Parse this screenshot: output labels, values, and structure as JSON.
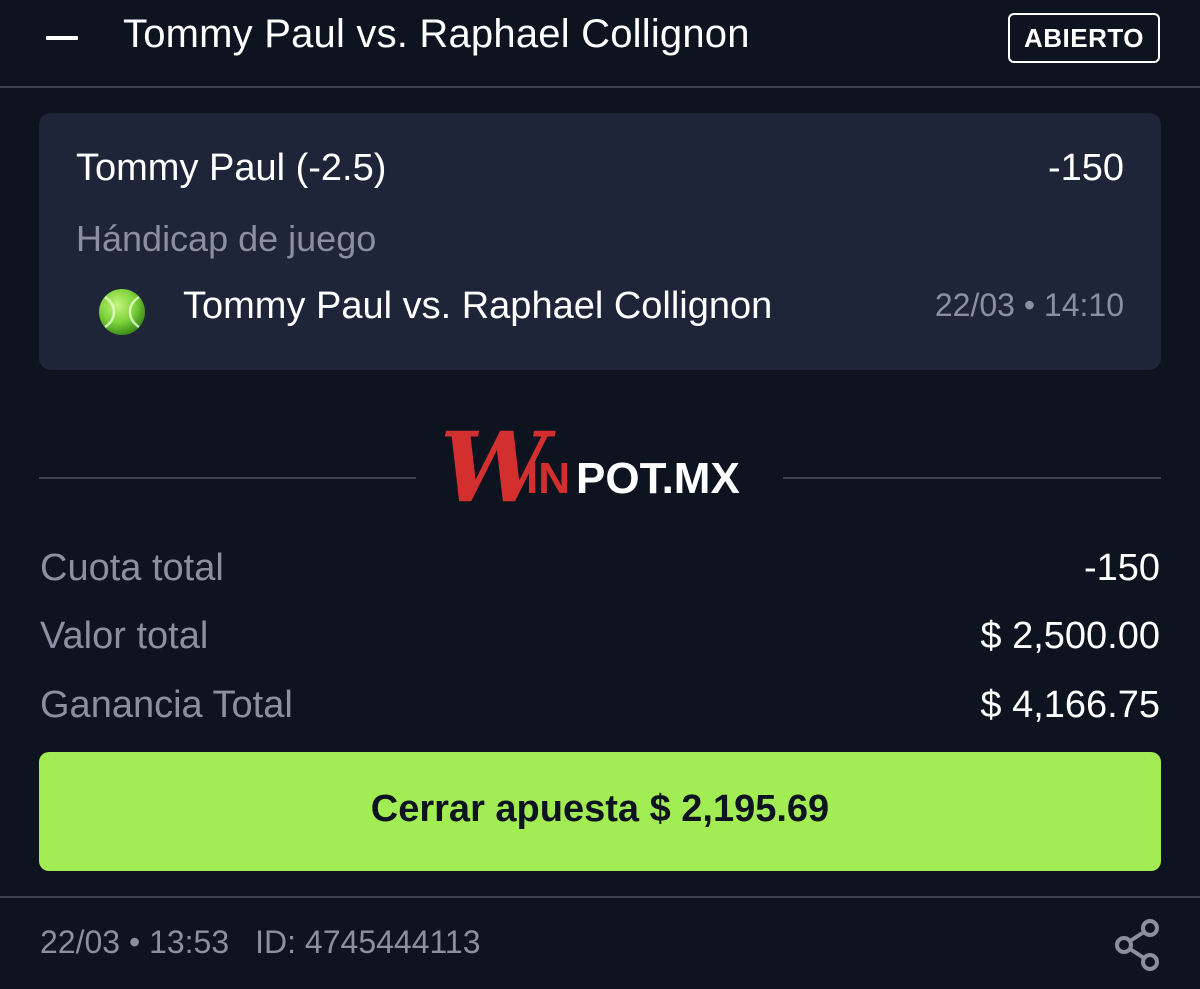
{
  "header": {
    "title": "Tommy Paul vs. Raphael Collignon",
    "status": "ABIERTO",
    "collapse_icon": "minus-icon"
  },
  "selection": {
    "name": "Tommy Paul (-2.5)",
    "odds": "-150",
    "market": "Hándicap de juego",
    "sport_icon": "tennis-ball-icon",
    "event": "Tommy Paul vs. Raphael Collignon",
    "datetime": "22/03 • 14:10"
  },
  "brand": {
    "logo_script": "W",
    "logo_in": "IN",
    "logo_rest": "POT.MX",
    "accent": "#d32f2f"
  },
  "totals": {
    "odds_label": "Cuota total",
    "odds_value": "-150",
    "stake_label": "Valor total",
    "stake_value": "$ 2,500.00",
    "payout_label": "Ganancia Total",
    "payout_value": "$ 4,166.75"
  },
  "cashout": {
    "label": "Cerrar apuesta $ 2,195.69",
    "color": "#a2ec54"
  },
  "footer": {
    "datetime": "22/03 • 13:53",
    "bet_id": "ID: 4745444113",
    "share_icon": "share-icon"
  }
}
